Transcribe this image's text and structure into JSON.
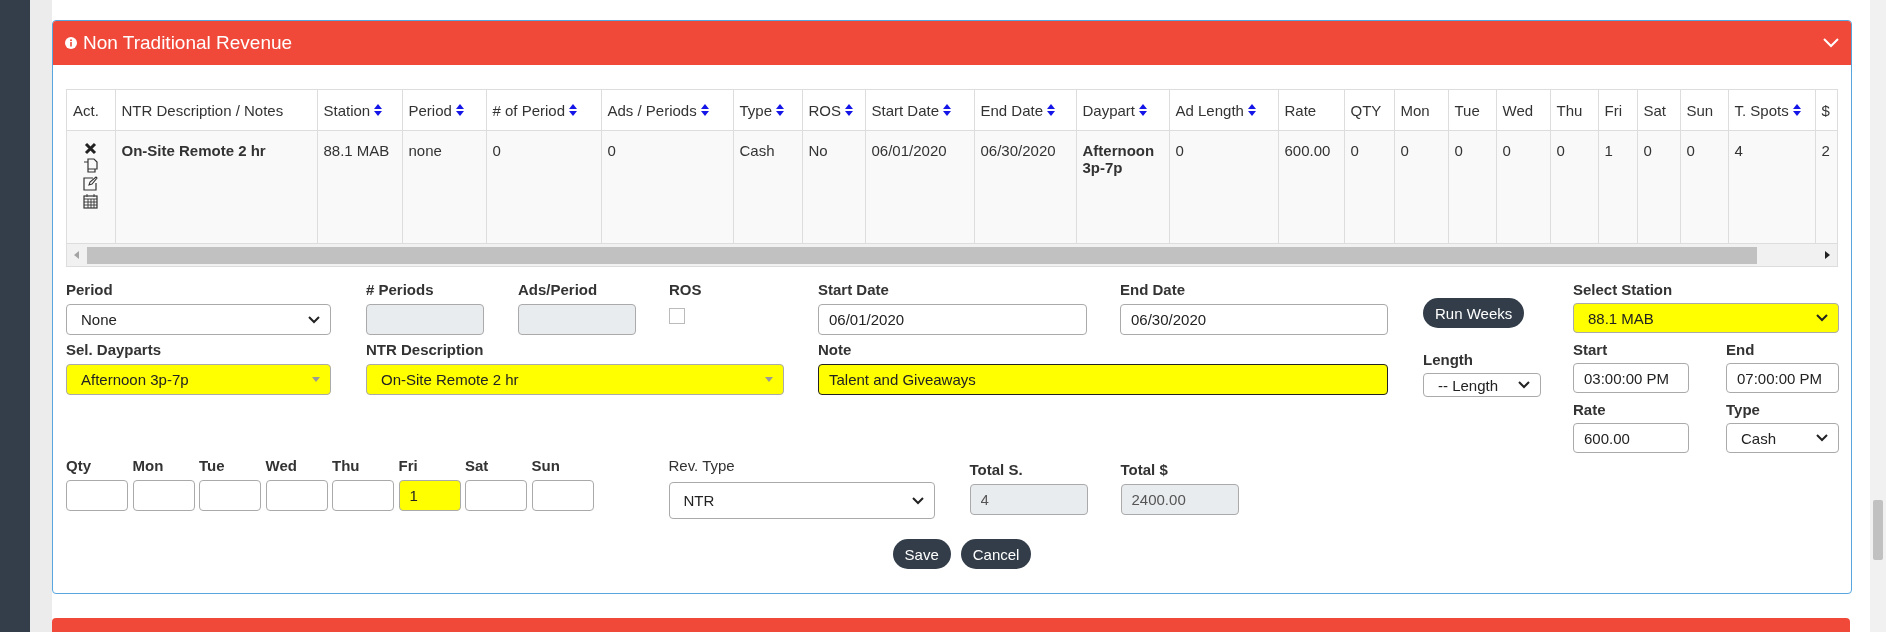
{
  "panel": {
    "title": "Non Traditional Revenue"
  },
  "table": {
    "columns": [
      {
        "label": "Act.",
        "sortable": false
      },
      {
        "label": "NTR Description / Notes",
        "sortable": false
      },
      {
        "label": "Station",
        "sortable": true
      },
      {
        "label": "Period",
        "sortable": true
      },
      {
        "label": "# of Period",
        "sortable": true
      },
      {
        "label": "Ads / Periods",
        "sortable": true
      },
      {
        "label": "Type",
        "sortable": true
      },
      {
        "label": "ROS",
        "sortable": true
      },
      {
        "label": "Start Date",
        "sortable": true
      },
      {
        "label": "End Date",
        "sortable": true
      },
      {
        "label": "Daypart",
        "sortable": true
      },
      {
        "label": "Ad Length",
        "sortable": true
      },
      {
        "label": "Rate",
        "sortable": false
      },
      {
        "label": "QTY",
        "sortable": false
      },
      {
        "label": "Mon",
        "sortable": false
      },
      {
        "label": "Tue",
        "sortable": false
      },
      {
        "label": "Wed",
        "sortable": false
      },
      {
        "label": "Thu",
        "sortable": false
      },
      {
        "label": "Fri",
        "sortable": false
      },
      {
        "label": "Sat",
        "sortable": false
      },
      {
        "label": "Sun",
        "sortable": false
      },
      {
        "label": "T. Spots",
        "sortable": true
      },
      {
        "label": "$",
        "sortable": false
      }
    ],
    "rows": [
      {
        "cells": [
          "",
          "On-Site Remote 2 hr",
          "88.1 MAB",
          "none",
          "0",
          "0",
          "Cash",
          "No",
          "06/01/2020",
          "06/30/2020",
          "Afternoon 3p-7p",
          "0",
          "600.00",
          "0",
          "0",
          "0",
          "0",
          "0",
          "1",
          "0",
          "0",
          "4",
          "2"
        ]
      }
    ]
  },
  "form": {
    "fields": [
      {
        "kind": "select",
        "label": "Period",
        "value": "None",
        "highlighted": false
      },
      {
        "kind": "input",
        "label": "# Periods",
        "disabled": true
      },
      {
        "kind": "input",
        "label": "Ads/Period",
        "disabled": true
      },
      {
        "kind": "checkbox",
        "label": "ROS",
        "checked": false
      },
      {
        "kind": "input",
        "label": "Start Date",
        "value": "06/01/2020",
        "disabled": false
      },
      {
        "kind": "input",
        "label": "End Date",
        "value": "06/30/2020",
        "disabled": false
      },
      {
        "kind": "button",
        "text": "Run Weeks"
      },
      {
        "kind": "combo",
        "label": "Sel. Dayparts",
        "value": "Afternoon 3p-7p",
        "highlighted": true
      },
      {
        "kind": "combo",
        "label": "NTR Description",
        "value": "On-Site Remote 2 hr",
        "highlighted": true
      },
      {
        "kind": "input",
        "label": "Note",
        "value": "Talent and Giveaways",
        "disabled": false,
        "highlighted": true,
        "focused": true
      },
      {
        "kind": "select",
        "label": "Length",
        "value": "-- Length",
        "highlighted": false
      },
      {
        "kind": "select",
        "label": "Select Station",
        "value": "88.1 MAB",
        "highlighted": true
      },
      {
        "kind": "input",
        "label": "Start",
        "value": "03:00:00 PM",
        "disabled": false
      },
      {
        "kind": "input",
        "label": "End",
        "value": "07:00:00 PM",
        "disabled": false
      },
      {
        "kind": "input",
        "label": "Rate",
        "value": "600.00",
        "disabled": false
      },
      {
        "kind": "select",
        "label": "Type",
        "value": "Cash",
        "highlighted": false
      },
      {
        "kind": "input",
        "label": "Qty",
        "disabled": false
      },
      {
        "kind": "input",
        "label": "Mon",
        "disabled": false
      },
      {
        "kind": "input",
        "label": "Tue",
        "disabled": false
      },
      {
        "kind": "input",
        "label": "Wed",
        "disabled": false
      },
      {
        "kind": "input",
        "label": "Thu",
        "disabled": false
      },
      {
        "kind": "input",
        "label": "Fri",
        "value": "1",
        "disabled": false,
        "highlighted": true
      },
      {
        "kind": "input",
        "label": "Sat",
        "disabled": false
      },
      {
        "kind": "input",
        "label": "Sun",
        "disabled": false
      },
      {
        "kind": "select",
        "label": "Rev. Type",
        "value": "NTR",
        "highlighted": false
      },
      {
        "kind": "input",
        "label": "Total S.",
        "value": "4",
        "disabled": true
      },
      {
        "kind": "input",
        "label": "Total $",
        "value": "2400.00",
        "disabled": true
      }
    ],
    "buttons": [
      "Save",
      "Cancel"
    ]
  }
}
